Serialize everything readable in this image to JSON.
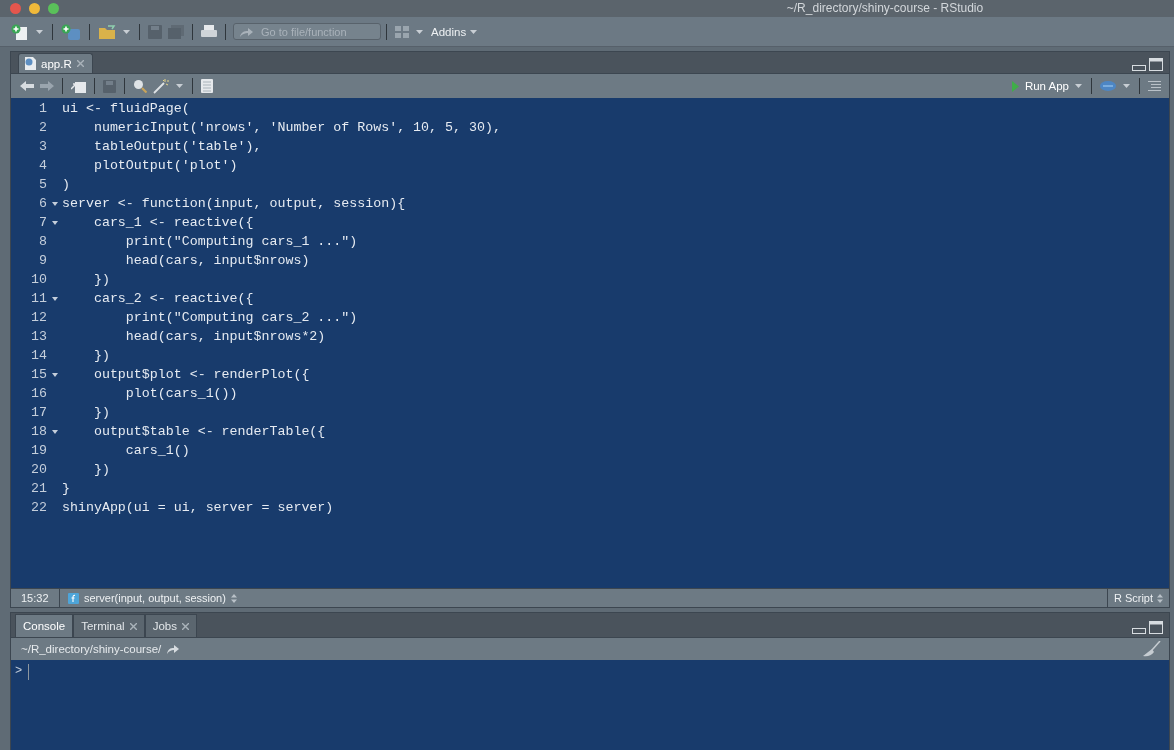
{
  "window": {
    "title": "~/R_directory/shiny-course - RStudio"
  },
  "toolbar": {
    "search": {
      "placeholder": "Go to file/function"
    },
    "addins": "Addins"
  },
  "source": {
    "tabs": [
      {
        "label": "app.R",
        "selected": true
      }
    ],
    "run_button": "Run App",
    "lines": [
      {
        "number": "1",
        "code": "ui <- fluidPage(",
        "foldable": false
      },
      {
        "number": "2",
        "code": "    numericInput('nrows', 'Number of Rows', 10, 5, 30),",
        "foldable": false
      },
      {
        "number": "3",
        "code": "    tableOutput('table'),",
        "foldable": false
      },
      {
        "number": "4",
        "code": "    plotOutput('plot')",
        "foldable": false
      },
      {
        "number": "5",
        "code": ")",
        "foldable": false
      },
      {
        "number": "6",
        "code": "server <- function(input, output, session){",
        "foldable": true
      },
      {
        "number": "7",
        "code": "    cars_1 <- reactive({",
        "foldable": true
      },
      {
        "number": "8",
        "code": "        print(\"Computing cars_1 ...\")",
        "foldable": false
      },
      {
        "number": "9",
        "code": "        head(cars, input$nrows)",
        "foldable": false
      },
      {
        "number": "10",
        "code": "    })",
        "foldable": false
      },
      {
        "number": "11",
        "code": "    cars_2 <- reactive({",
        "foldable": true
      },
      {
        "number": "12",
        "code": "        print(\"Computing cars_2 ...\")",
        "foldable": false
      },
      {
        "number": "13",
        "code": "        head(cars, input$nrows*2)",
        "foldable": false
      },
      {
        "number": "14",
        "code": "    })",
        "foldable": false
      },
      {
        "number": "15",
        "code": "    output$plot <- renderPlot({",
        "foldable": true
      },
      {
        "number": "16",
        "code": "        plot(cars_1())",
        "foldable": false
      },
      {
        "number": "17",
        "code": "    })",
        "foldable": false
      },
      {
        "number": "18",
        "code": "    output$table <- renderTable({",
        "foldable": true
      },
      {
        "number": "19",
        "code": "        cars_1()",
        "foldable": false
      },
      {
        "number": "20",
        "code": "    })",
        "foldable": false
      },
      {
        "number": "21",
        "code": "}",
        "foldable": false
      },
      {
        "number": "22",
        "code": "shinyApp(ui = ui, server = server)",
        "foldable": false
      }
    ],
    "status": {
      "position": "15:32",
      "scope": "server(input, output, session)",
      "file_type": "R Script"
    }
  },
  "console": {
    "tabs": [
      {
        "label": "Console",
        "selected": true,
        "closable": false
      },
      {
        "label": "Terminal",
        "selected": false,
        "closable": true
      },
      {
        "label": "Jobs",
        "selected": false,
        "closable": true
      }
    ],
    "path": "~/R_directory/shiny-course/",
    "prompt": ">"
  }
}
